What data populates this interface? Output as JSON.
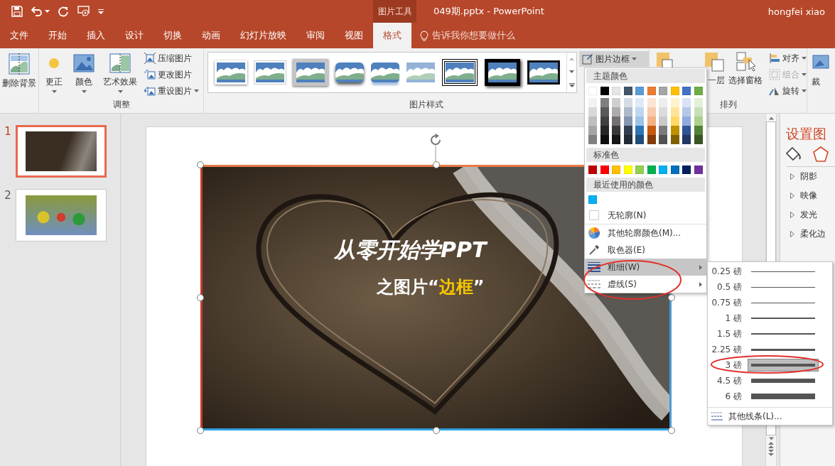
{
  "window": {
    "context_tab_group": "图片工具",
    "title": "049期.pptx - PowerPoint",
    "user": "hongfei xiao"
  },
  "ribbon_tabs": [
    {
      "label": "文件",
      "selected": false
    },
    {
      "label": "开始",
      "selected": false
    },
    {
      "label": "插入",
      "selected": false
    },
    {
      "label": "设计",
      "selected": false
    },
    {
      "label": "切换",
      "selected": false
    },
    {
      "label": "动画",
      "selected": false
    },
    {
      "label": "幻灯片放映",
      "selected": false
    },
    {
      "label": "审阅",
      "selected": false
    },
    {
      "label": "视图",
      "selected": false
    },
    {
      "label": "格式",
      "selected": true
    }
  ],
  "tell_me": {
    "placeholder": "告诉我你想要做什么"
  },
  "ribbon": {
    "remove_background": "删除背景",
    "adjust": {
      "label": "调整",
      "large_buttons": [
        {
          "kind": "corrections",
          "label": "更正"
        },
        {
          "kind": "color",
          "label": "颜色"
        },
        {
          "kind": "artistic",
          "label": "艺术效果"
        }
      ],
      "small_buttons": [
        {
          "kind": "compress",
          "label": "压缩图片"
        },
        {
          "kind": "change",
          "label": "更改图片"
        },
        {
          "kind": "reset",
          "label": "重设图片"
        }
      ]
    },
    "picture_styles": {
      "label": "图片样式",
      "styles": [
        {
          "kind": "simple-frame"
        },
        {
          "kind": "thin-white"
        },
        {
          "kind": "gray-matte"
        },
        {
          "kind": "rounded-shadow"
        },
        {
          "kind": "reflected"
        },
        {
          "kind": "soft-edge"
        },
        {
          "kind": "double-black"
        },
        {
          "kind": "thick-black"
        },
        {
          "kind": "thin-black"
        }
      ],
      "border_button": {
        "label": "图片边框",
        "expanded": true
      }
    },
    "arrange": {
      "label": "排列",
      "send_backward": "一层",
      "selection_pane": "选择窗格",
      "small_buttons": [
        {
          "kind": "align",
          "label": "对齐",
          "disabled": false
        },
        {
          "kind": "group",
          "label": "组合",
          "disabled": true
        },
        {
          "kind": "rotate",
          "label": "旋转",
          "disabled": false
        }
      ]
    },
    "crop": "裁"
  },
  "slides": [
    {
      "number": "1",
      "selected": true
    },
    {
      "number": "2",
      "selected": false
    }
  ],
  "slide": {
    "title": "从零开始学PPT",
    "subtitle": {
      "before": "之图片“",
      "highlight": "边框",
      "after": "”"
    },
    "picture_selected": true
  },
  "format_pane": {
    "title": "设置图",
    "tabs": [
      {
        "kind": "fill",
        "selected": false
      },
      {
        "kind": "effects",
        "selected": true
      }
    ],
    "sections": [
      "阴影",
      "映像",
      "发光",
      "柔化边"
    ]
  },
  "border_menu": {
    "theme_colors_label": "主题颜色",
    "theme_colors": [
      {
        "color": "#ffffff",
        "shades": [
          {
            "color": "#f2f2f2"
          },
          {
            "color": "#d9d9d9"
          },
          {
            "color": "#bfbfbf"
          },
          {
            "color": "#a6a6a6"
          },
          {
            "color": "#808080"
          }
        ]
      },
      {
        "color": "#000000",
        "shades": [
          {
            "color": "#7f7f7f"
          },
          {
            "color": "#595959"
          },
          {
            "color": "#404040"
          },
          {
            "color": "#262626"
          },
          {
            "color": "#0d0d0d"
          }
        ]
      },
      {
        "color": "#e7e6e6",
        "shades": [
          {
            "color": "#d0cece"
          },
          {
            "color": "#aeabab"
          },
          {
            "color": "#757171"
          },
          {
            "color": "#3a3838"
          },
          {
            "color": "#171616"
          }
        ]
      },
      {
        "color": "#44546a",
        "shades": [
          {
            "color": "#d6dce4"
          },
          {
            "color": "#adb9ca"
          },
          {
            "color": "#8496b0"
          },
          {
            "color": "#333f4f"
          },
          {
            "color": "#222a35"
          }
        ]
      },
      {
        "color": "#5b9bd5",
        "shades": [
          {
            "color": "#deebf6"
          },
          {
            "color": "#bdd7ee"
          },
          {
            "color": "#9dc3e6"
          },
          {
            "color": "#2e75b5"
          },
          {
            "color": "#1e4e79"
          }
        ]
      },
      {
        "color": "#ed7d31",
        "shades": [
          {
            "color": "#fbe5d5"
          },
          {
            "color": "#f7cbac"
          },
          {
            "color": "#f4b183"
          },
          {
            "color": "#c55a11"
          },
          {
            "color": "#843c0b"
          }
        ]
      },
      {
        "color": "#a5a5a5",
        "shades": [
          {
            "color": "#ededed"
          },
          {
            "color": "#dbdbdb"
          },
          {
            "color": "#c9c9c9"
          },
          {
            "color": "#7b7b7b"
          },
          {
            "color": "#525252"
          }
        ]
      },
      {
        "color": "#ffc000",
        "shades": [
          {
            "color": "#fff2cc"
          },
          {
            "color": "#fee599"
          },
          {
            "color": "#ffd965"
          },
          {
            "color": "#bf9000"
          },
          {
            "color": "#7f6000"
          }
        ]
      },
      {
        "color": "#4472c4",
        "shades": [
          {
            "color": "#dae3f3"
          },
          {
            "color": "#b4c7e7"
          },
          {
            "color": "#8faadc"
          },
          {
            "color": "#2f5597"
          },
          {
            "color": "#203864"
          }
        ]
      },
      {
        "color": "#70ad47",
        "shades": [
          {
            "color": "#e2f0d9"
          },
          {
            "color": "#c5e0b4"
          },
          {
            "color": "#a9d18e"
          },
          {
            "color": "#538135"
          },
          {
            "color": "#375623"
          }
        ]
      }
    ],
    "standard_colors_label": "标准色",
    "standard_colors": [
      {
        "color": "#c00000"
      },
      {
        "color": "#ff0000"
      },
      {
        "color": "#ffc000"
      },
      {
        "color": "#ffff00"
      },
      {
        "color": "#92d050"
      },
      {
        "color": "#00b050"
      },
      {
        "color": "#00b0f0"
      },
      {
        "color": "#0070c0"
      },
      {
        "color": "#002060"
      },
      {
        "color": "#7030a0"
      }
    ],
    "recent_label": "最近使用的颜色",
    "recent_colors": [
      {
        "color": "#00b0f0"
      }
    ],
    "items": [
      {
        "kind": "no-outline",
        "label": "无轮廓(N)",
        "highlighted": false,
        "submenu": false
      },
      {
        "kind": "more-colors",
        "label": "其他轮廓颜色(M)...",
        "highlighted": false,
        "submenu": false
      },
      {
        "kind": "eyedropper",
        "label": "取色器(E)",
        "highlighted": false,
        "submenu": false
      },
      {
        "kind": "weight",
        "label": "粗细(W)",
        "highlighted": true,
        "submenu": true
      },
      {
        "kind": "dashes",
        "label": "虚线(S)",
        "highlighted": false,
        "submenu": true
      }
    ]
  },
  "weight_menu": {
    "items": [
      {
        "label": "0.25 磅",
        "selected": false
      },
      {
        "label": "0.5 磅",
        "selected": false
      },
      {
        "label": "0.75 磅",
        "selected": false
      },
      {
        "label": "1 磅",
        "selected": false
      },
      {
        "label": "1.5 磅",
        "selected": false
      },
      {
        "label": "2.25 磅",
        "selected": false
      },
      {
        "label": "3 磅",
        "selected": true
      },
      {
        "label": "4.5 磅",
        "selected": false
      },
      {
        "label": "6 磅",
        "selected": false
      }
    ],
    "more": "其他线条(L)..."
  }
}
